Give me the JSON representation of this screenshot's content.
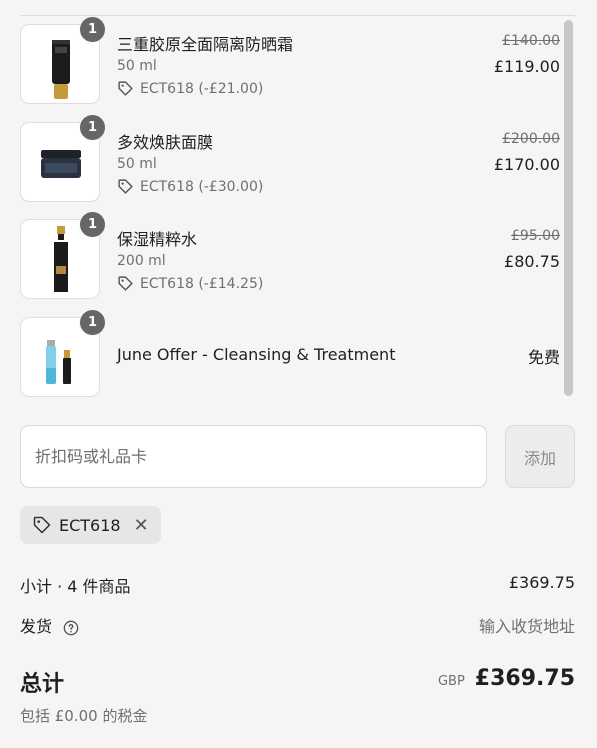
{
  "items": [
    {
      "qty": "1",
      "name": "三重胶原全面隔离防晒霜",
      "variant": "50 ml",
      "discount": "ECT618 (-£21.00)",
      "original_price": "£140.00",
      "price": "£119.00"
    },
    {
      "qty": "1",
      "name": "多效焕肤面膜",
      "variant": "50 ml",
      "discount": "ECT618 (-£30.00)",
      "original_price": "£200.00",
      "price": "£170.00"
    },
    {
      "qty": "1",
      "name": "保湿精粹水",
      "variant": "200 ml",
      "discount": "ECT618 (-£14.25)",
      "original_price": "£95.00",
      "price": "£80.75"
    },
    {
      "qty": "1",
      "name": "June Offer - Cleansing & Treatment",
      "price": "免费"
    }
  ],
  "discount_field": {
    "placeholder": "折扣码或礼品卡",
    "value": ""
  },
  "add_button": "添加",
  "applied_code": "ECT618",
  "summary": {
    "subtotal_label": "小计 · 4 件商品",
    "subtotal_value": "£369.75",
    "shipping_label": "发货",
    "shipping_value": "输入收货地址",
    "total_label": "总计",
    "currency": "GBP",
    "total_value": "£369.75",
    "tax_note": "包括 £0.00 的税金"
  },
  "colors": {
    "background": "#f5f5f5",
    "badge": "#666666",
    "muted_text": "#707070"
  }
}
